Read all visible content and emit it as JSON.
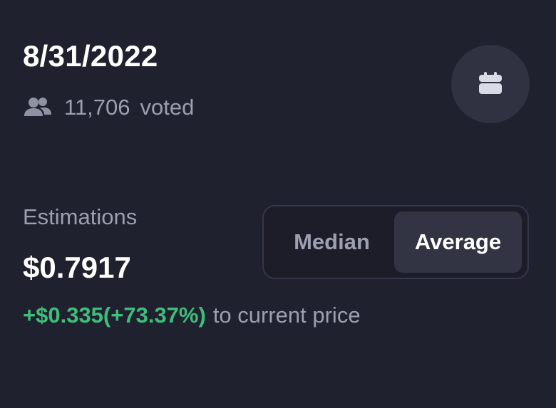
{
  "header": {
    "date": "8/31/2022",
    "votes_count": "11,706",
    "votes_label": "voted"
  },
  "icons": {
    "users": "users-icon",
    "calendar": "calendar-icon"
  },
  "estimations": {
    "label": "Estimations",
    "price": "$0.7917",
    "change": "+$0.335(+73.37%)",
    "change_suffix": "to current price"
  },
  "toggle": {
    "options": [
      "Median",
      "Average"
    ],
    "selected": "Average"
  },
  "colors": {
    "background": "#20212e",
    "positive": "#3dbe7b",
    "muted_text": "#9b9fb0",
    "selected_option_bg": "#323444"
  }
}
